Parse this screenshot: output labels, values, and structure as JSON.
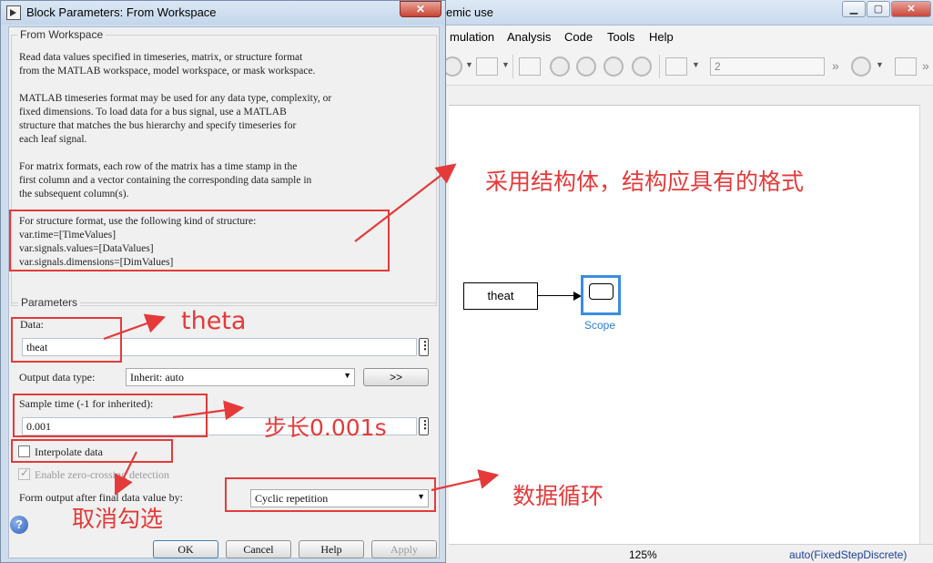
{
  "simulink": {
    "title": "emic use",
    "menu": [
      "mulation",
      "Analysis",
      "Code",
      "Tools",
      "Help"
    ],
    "stop_time": "2",
    "status_zoom": "125%",
    "status_solver": "auto(FixedStepDiscrete)",
    "from_workspace_label": "theat",
    "scope_label": "Scope"
  },
  "dialog": {
    "title": "Block Parameters: From Workspace",
    "group_title": "From Workspace",
    "desc1": "Read data values specified in timeseries, matrix, or structure format\nfrom the MATLAB workspace, model workspace, or mask workspace.",
    "desc2": "MATLAB timeseries format may be used for any data type, complexity, or\nfixed dimensions. To load data for a bus signal, use a MATLAB\nstructure that matches the bus hierarchy and specify timeseries for\neach leaf signal.",
    "desc3": "For matrix formats, each row of the matrix has a time stamp in the\nfirst column and a vector containing the corresponding data sample in\nthe subsequent column(s).",
    "desc4": "For structure format, use the following kind of structure:\n  var.time=[TimeValues]\n  var.signals.values=[DataValues]\n  var.signals.dimensions=[DimValues]",
    "params_title": "Parameters",
    "data_label": "Data:",
    "data_value": "theat",
    "dots": "⋮",
    "output_type_label": "Output data type:",
    "output_type_value": "Inherit: auto",
    "assistant_label": ">>",
    "sample_time_label": "Sample time (-1 for inherited):",
    "sample_time_value": "0.001",
    "interpolate_label": "Interpolate data",
    "interpolate_checked": false,
    "zero_crossing_label": "Enable zero-crossing detection",
    "zero_crossing_checked": true,
    "form_output_label": "Form output after final data value by:",
    "form_output_value": "Cyclic repetition",
    "ok_label": "OK",
    "cancel_label": "Cancel",
    "help_label": "Help",
    "apply_label": "Apply"
  },
  "annotations": {
    "structure_note": "采用结构体，结构应具有的格式",
    "data_note": "theta",
    "step_note": "步长0.001s",
    "uncheck_note": "取消勾选",
    "cycle_note": "数据循环"
  },
  "colors": {
    "annotation": "#e53a3a",
    "scope_border": "#3a8de0",
    "solver_text": "#1a3e9a"
  }
}
